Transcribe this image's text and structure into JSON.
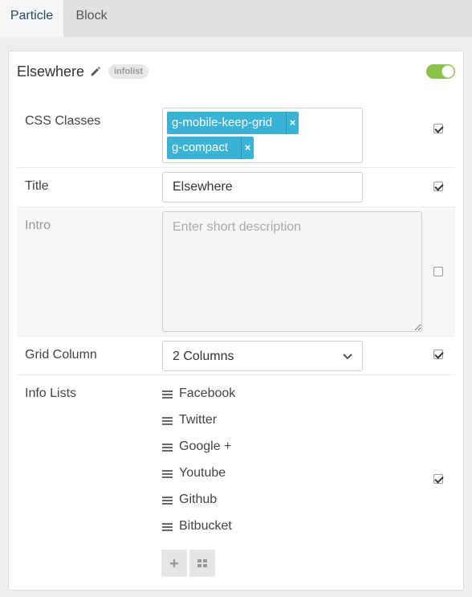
{
  "tabs": [
    {
      "label": "Particle",
      "active": true
    },
    {
      "label": "Block",
      "active": false
    }
  ],
  "header": {
    "title": "Elsewhere",
    "badge": "infolist",
    "enabled": true
  },
  "fields": {
    "css_classes": {
      "label": "CSS Classes",
      "tags": [
        "g-mobile-keep-grid",
        "g-compact"
      ],
      "tag_remove": "×",
      "checked": true
    },
    "title": {
      "label": "Title",
      "value": "Elsewhere",
      "checked": true
    },
    "intro": {
      "label": "Intro",
      "placeholder": "Enter short description",
      "value": "",
      "checked": false
    },
    "grid_column": {
      "label": "Grid Column",
      "selected": "2 Columns",
      "checked": true
    },
    "info_lists": {
      "label": "Info Lists",
      "items": [
        "Facebook",
        "Twitter",
        "Google +",
        "Youtube",
        "Github",
        "Bitbucket"
      ],
      "checked": true
    }
  },
  "colors": {
    "tag_blue": "#3ab3d7",
    "toggle_green": "#8bc34a"
  },
  "icons": {
    "edit": "pencil-icon",
    "remove": "close-icon",
    "dropdown": "chevron-down-icon",
    "drag": "drag-handle-icon",
    "add": "plus-icon",
    "grid": "grid-icon"
  }
}
